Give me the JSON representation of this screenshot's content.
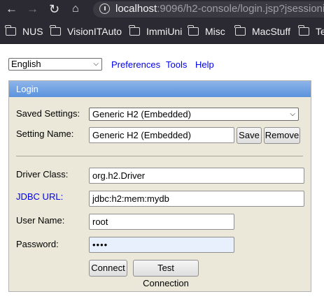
{
  "browser": {
    "url_host": "localhost",
    "url_rest": ":9096/h2-console/login.jsp?jsessionid",
    "bookmarks": [
      "NUS",
      "VisionITAuto",
      "ImmiUni",
      "Misc",
      "MacStuff",
      "Te"
    ]
  },
  "top": {
    "language": "English",
    "links": [
      "Preferences",
      "Tools",
      "Help"
    ]
  },
  "login": {
    "title": "Login",
    "saved_settings_label": "Saved Settings:",
    "saved_settings_value": "Generic H2 (Embedded)",
    "setting_name_label": "Setting Name:",
    "setting_name_value": "Generic H2 (Embedded)",
    "save_label": "Save",
    "remove_label": "Remove",
    "driver_class_label": "Driver Class:",
    "driver_class_value": "org.h2.Driver",
    "jdbc_url_label": "JDBC URL:",
    "jdbc_url_value": "jdbc:h2:mem:mydb",
    "user_name_label": "User Name:",
    "user_name_value": "root",
    "password_label": "Password:",
    "password_value": "••••",
    "connect_label": "Connect",
    "test_connection_label": "Test Connection"
  }
}
